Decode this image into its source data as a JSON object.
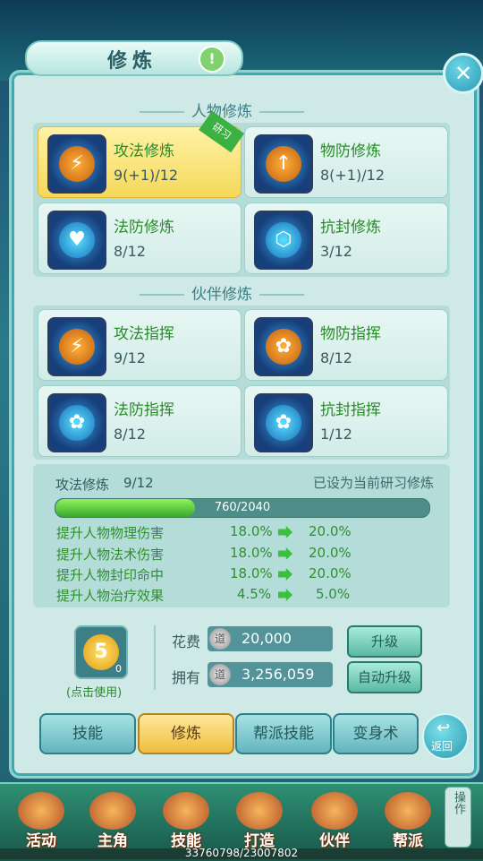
{
  "window": {
    "title": "修炼"
  },
  "sections": {
    "character": "人物修炼",
    "partner": "伙伴修炼"
  },
  "character_cards": [
    {
      "name": "攻法修炼",
      "level": "9(+1)/12",
      "tag": "研习",
      "icon": "lightning-shield-icon"
    },
    {
      "name": "物防修炼",
      "level": "8(+1)/12",
      "icon": "sword-shield-icon"
    },
    {
      "name": "法防修炼",
      "level": "8/12",
      "icon": "heart-shield-icon"
    },
    {
      "name": "抗封修炼",
      "level": "3/12",
      "icon": "turtle-shell-icon"
    }
  ],
  "partner_cards": [
    {
      "name": "攻法指挥",
      "level": "9/12",
      "icon": "lightning-shield-icon"
    },
    {
      "name": "物防指挥",
      "level": "8/12",
      "icon": "paw-shield-icon"
    },
    {
      "name": "法防指挥",
      "level": "8/12",
      "icon": "paw-shield-icon"
    },
    {
      "name": "抗封指挥",
      "level": "1/12",
      "icon": "paw-orb-icon"
    }
  ],
  "detail": {
    "name": "攻法修炼",
    "level": "9/12",
    "note": "已设为当前研习修炼",
    "progress_text": "760/2040",
    "progress_fraction": 0.3725,
    "stats": [
      {
        "label": "提升人物物理伤害",
        "current": "18.0%",
        "next": "20.0%"
      },
      {
        "label": "提升人物法术伤害",
        "current": "18.0%",
        "next": "20.0%"
      },
      {
        "label": "提升人物封印命中",
        "current": "18.0%",
        "next": "20.0%"
      },
      {
        "label": "提升人物治疗效果",
        "current": "4.5%",
        "next": "5.0%"
      }
    ]
  },
  "item": {
    "count": "0",
    "label": "(点击使用)",
    "glyph": "5"
  },
  "cost": {
    "cost_label": "花费",
    "cost_value": "20,000",
    "own_label": "拥有",
    "own_value": "3,256,059",
    "coin_glyph": "道",
    "upgrade_btn": "升级",
    "auto_btn": "自动升级"
  },
  "tabs": [
    {
      "label": "技能",
      "active": false
    },
    {
      "label": "修炼",
      "active": true
    },
    {
      "label": "帮派技能",
      "active": false
    },
    {
      "label": "变身术",
      "active": false
    }
  ],
  "back": {
    "icon": "back-arrow-icon",
    "label": "返回"
  },
  "bottom_nav": [
    {
      "label": "活动",
      "icon": "gourd-icon"
    },
    {
      "label": "主角",
      "icon": "hero-portrait-icon"
    },
    {
      "label": "技能",
      "icon": "book-icon"
    },
    {
      "label": "打造",
      "icon": "hammer-icon"
    },
    {
      "label": "伙伴",
      "icon": "partners-icon"
    },
    {
      "label": "帮派",
      "icon": "banner-icon"
    }
  ],
  "op_label": "操作",
  "hp_text": "33760798/23007802",
  "colors": {
    "accent_green": "#2a8a2a",
    "selected_card": "#f5d85a",
    "panel_bg": "#cfe9e6"
  }
}
